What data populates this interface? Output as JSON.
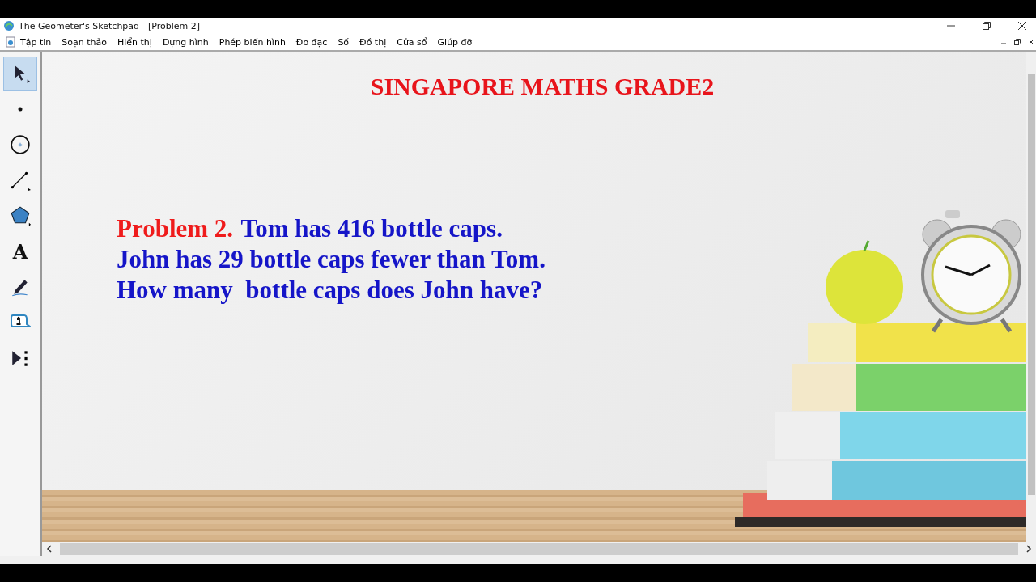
{
  "window": {
    "title": "The Geometer's Sketchpad - [Problem 2]"
  },
  "menu": [
    "Tập tin",
    "Soạn thảo",
    "Hiển thị",
    "Dựng hình",
    "Phép biến hình",
    "Đo đạc",
    "Số",
    "Đồ thị",
    "Cửa sổ",
    "Giúp đỡ"
  ],
  "toolbox": [
    {
      "kind": "arrow",
      "selected": true
    },
    {
      "kind": "point",
      "selected": false
    },
    {
      "kind": "compass",
      "selected": false
    },
    {
      "kind": "line",
      "selected": false
    },
    {
      "kind": "polygon",
      "selected": false
    },
    {
      "kind": "text",
      "glyph": "A",
      "selected": false
    },
    {
      "kind": "marker",
      "selected": false
    },
    {
      "kind": "info",
      "selected": false
    },
    {
      "kind": "custom",
      "selected": false
    }
  ],
  "sketch": {
    "title": "SINGAPORE MATHS GRADE2",
    "problem": {
      "label": "Problem 2.",
      "lines": [
        "Tom has 416 bottle caps.",
        "John has 29 bottle caps fewer than Tom.",
        "How many  bottle caps does John have?"
      ]
    }
  }
}
